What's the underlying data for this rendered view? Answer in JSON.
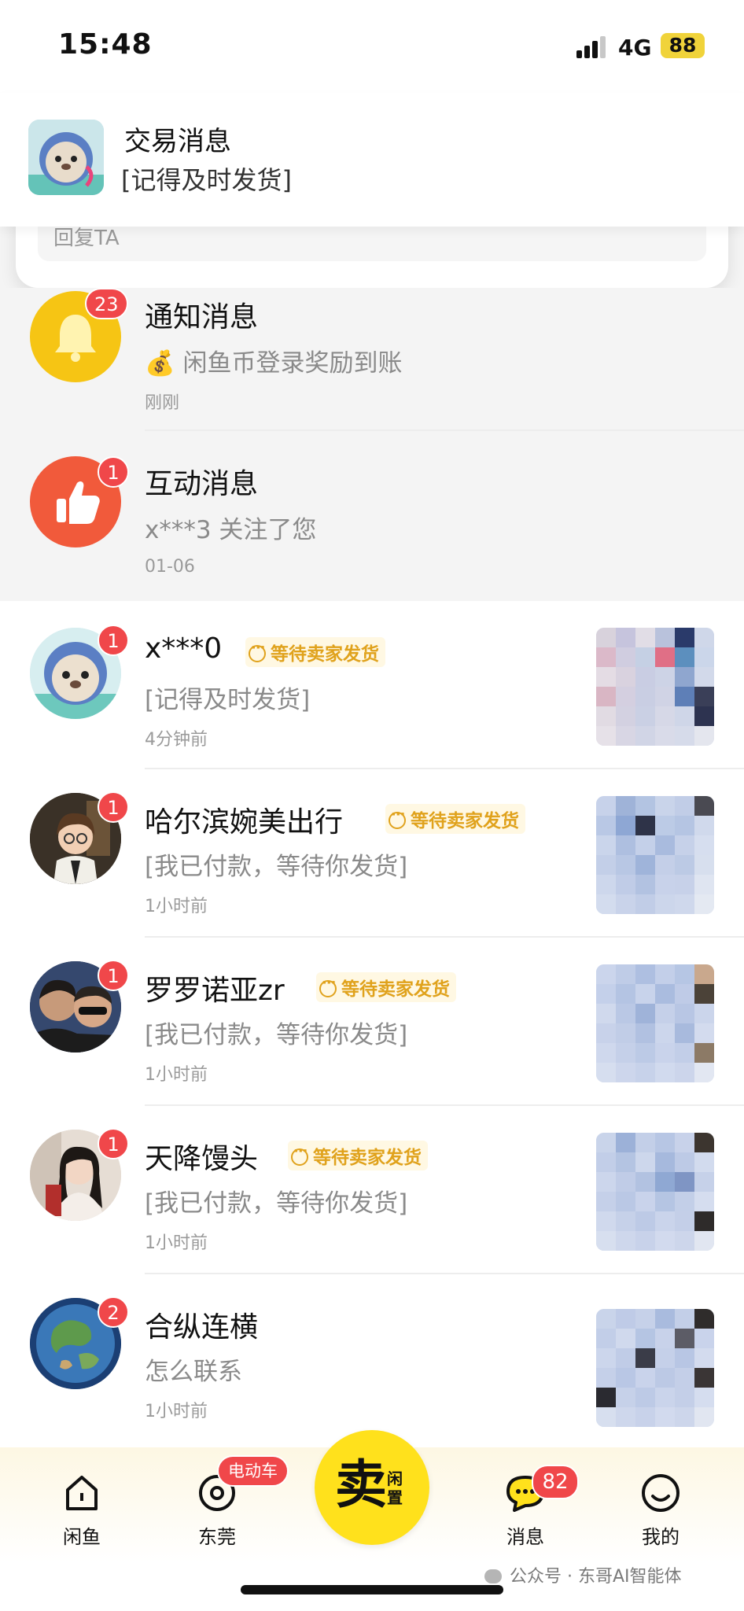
{
  "status_bar": {
    "time": "15:48",
    "network": "4G",
    "battery": "88"
  },
  "banner": {
    "title": "交易消息",
    "subtitle": "[记得及时发货]",
    "reply_placeholder": "回复TA"
  },
  "system_rows": [
    {
      "title": "通知消息",
      "preview": "💰 闲鱼币登录奖励到账",
      "time": "刚刚",
      "badge": "23",
      "icon": "bell-icon",
      "color": "#f5c518"
    },
    {
      "title": "互动消息",
      "preview": "x***3 关注了您",
      "time": "01-06",
      "badge": "1",
      "icon": "thumbs-up-icon",
      "color": "#f05a3c"
    }
  ],
  "chat_rows": [
    {
      "name": "x***0",
      "tag": "等待卖家发货",
      "preview": "[记得及时发货]",
      "time": "4分钟前",
      "badge": "1"
    },
    {
      "name": "哈尔滨婉美出行",
      "tag": "等待卖家发货",
      "preview": "[我已付款，等待你发货]",
      "time": "1小时前",
      "badge": "1"
    },
    {
      "name": "罗罗诺亚zr",
      "tag": "等待卖家发货",
      "preview": "[我已付款，等待你发货]",
      "time": "1小时前",
      "badge": "1"
    },
    {
      "name": "天降馒头",
      "tag": "等待卖家发货",
      "preview": "[我已付款，等待你发货]",
      "time": "1小时前",
      "badge": "1"
    },
    {
      "name": "合纵连横",
      "tag": "",
      "preview": "怎么联系",
      "time": "1小时前",
      "badge": "2"
    }
  ],
  "tabbar": {
    "home": "闲鱼",
    "local": "东莞",
    "local_badge": "电动车",
    "sell_big": "卖",
    "sell_small": "闲置",
    "messages": "消息",
    "messages_badge": "82",
    "mine": "我的"
  },
  "watermark": "公众号 · 东哥AI智能体"
}
